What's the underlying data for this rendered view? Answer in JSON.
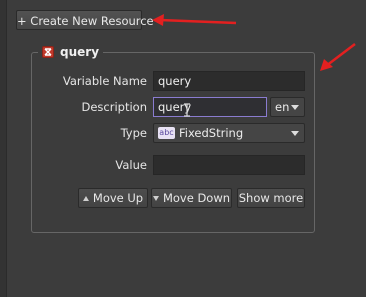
{
  "toolbar": {
    "create_label": "+ Create New Resource"
  },
  "resource": {
    "title": "query",
    "variable_name_label": "Variable Name",
    "variable_name_value": "query",
    "description_label": "Description",
    "description_value": "query",
    "language": "en",
    "type_label": "Type",
    "type_badge": "abc",
    "type_value": "FixedString",
    "value_label": "Value",
    "value_value": ""
  },
  "buttons": {
    "move_up": "Move Up",
    "move_down": "Move Down",
    "show_more": "Show more"
  },
  "colors": {
    "annotation_arrow": "#e32020",
    "focus_border": "#8a7cd0",
    "collapse_icon": "#c0392b"
  },
  "icons": [
    "collapse-icon",
    "arrow-up-icon",
    "arrow-down-icon",
    "dropdown-caret-icon",
    "text-cursor-icon"
  ]
}
